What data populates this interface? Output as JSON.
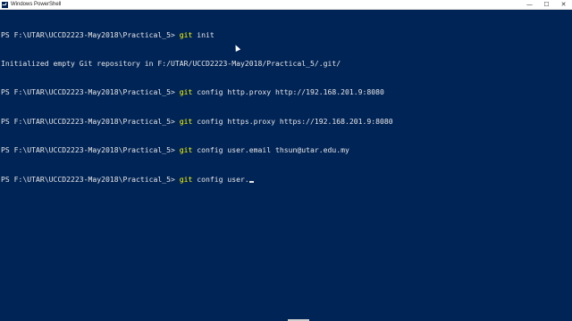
{
  "window": {
    "title": "Windows PowerShell",
    "icon": "powershell-icon",
    "controls": {
      "minimize": "—",
      "maximize": "☐",
      "close": "✕"
    },
    "colors": {
      "background": "#012456",
      "text": "#e6e6e6",
      "command": "#ffff00"
    }
  },
  "console": {
    "lines": [
      {
        "prompt": "PS F:\\UTAR\\UCCD2223-May2018\\Practical_5> ",
        "command": "git",
        "args": " init"
      },
      {
        "output": "Initialized empty Git repository in F:/UTAR/UCCD2223-May2018/Practical_5/.git/"
      },
      {
        "prompt": "PS F:\\UTAR\\UCCD2223-May2018\\Practical_5> ",
        "command": "git",
        "args": " config http.proxy http://192.168.201.9:8080"
      },
      {
        "prompt": "PS F:\\UTAR\\UCCD2223-May2018\\Practical_5> ",
        "command": "git",
        "args": " config https.proxy https://192.168.201.9:8080"
      },
      {
        "prompt": "PS F:\\UTAR\\UCCD2223-May2018\\Practical_5> ",
        "command": "git",
        "args": " config user.email thsun@utar.edu.my"
      },
      {
        "prompt": "PS F:\\UTAR\\UCCD2223-May2018\\Practical_5> ",
        "command": "git",
        "args": " config user."
      }
    ]
  }
}
